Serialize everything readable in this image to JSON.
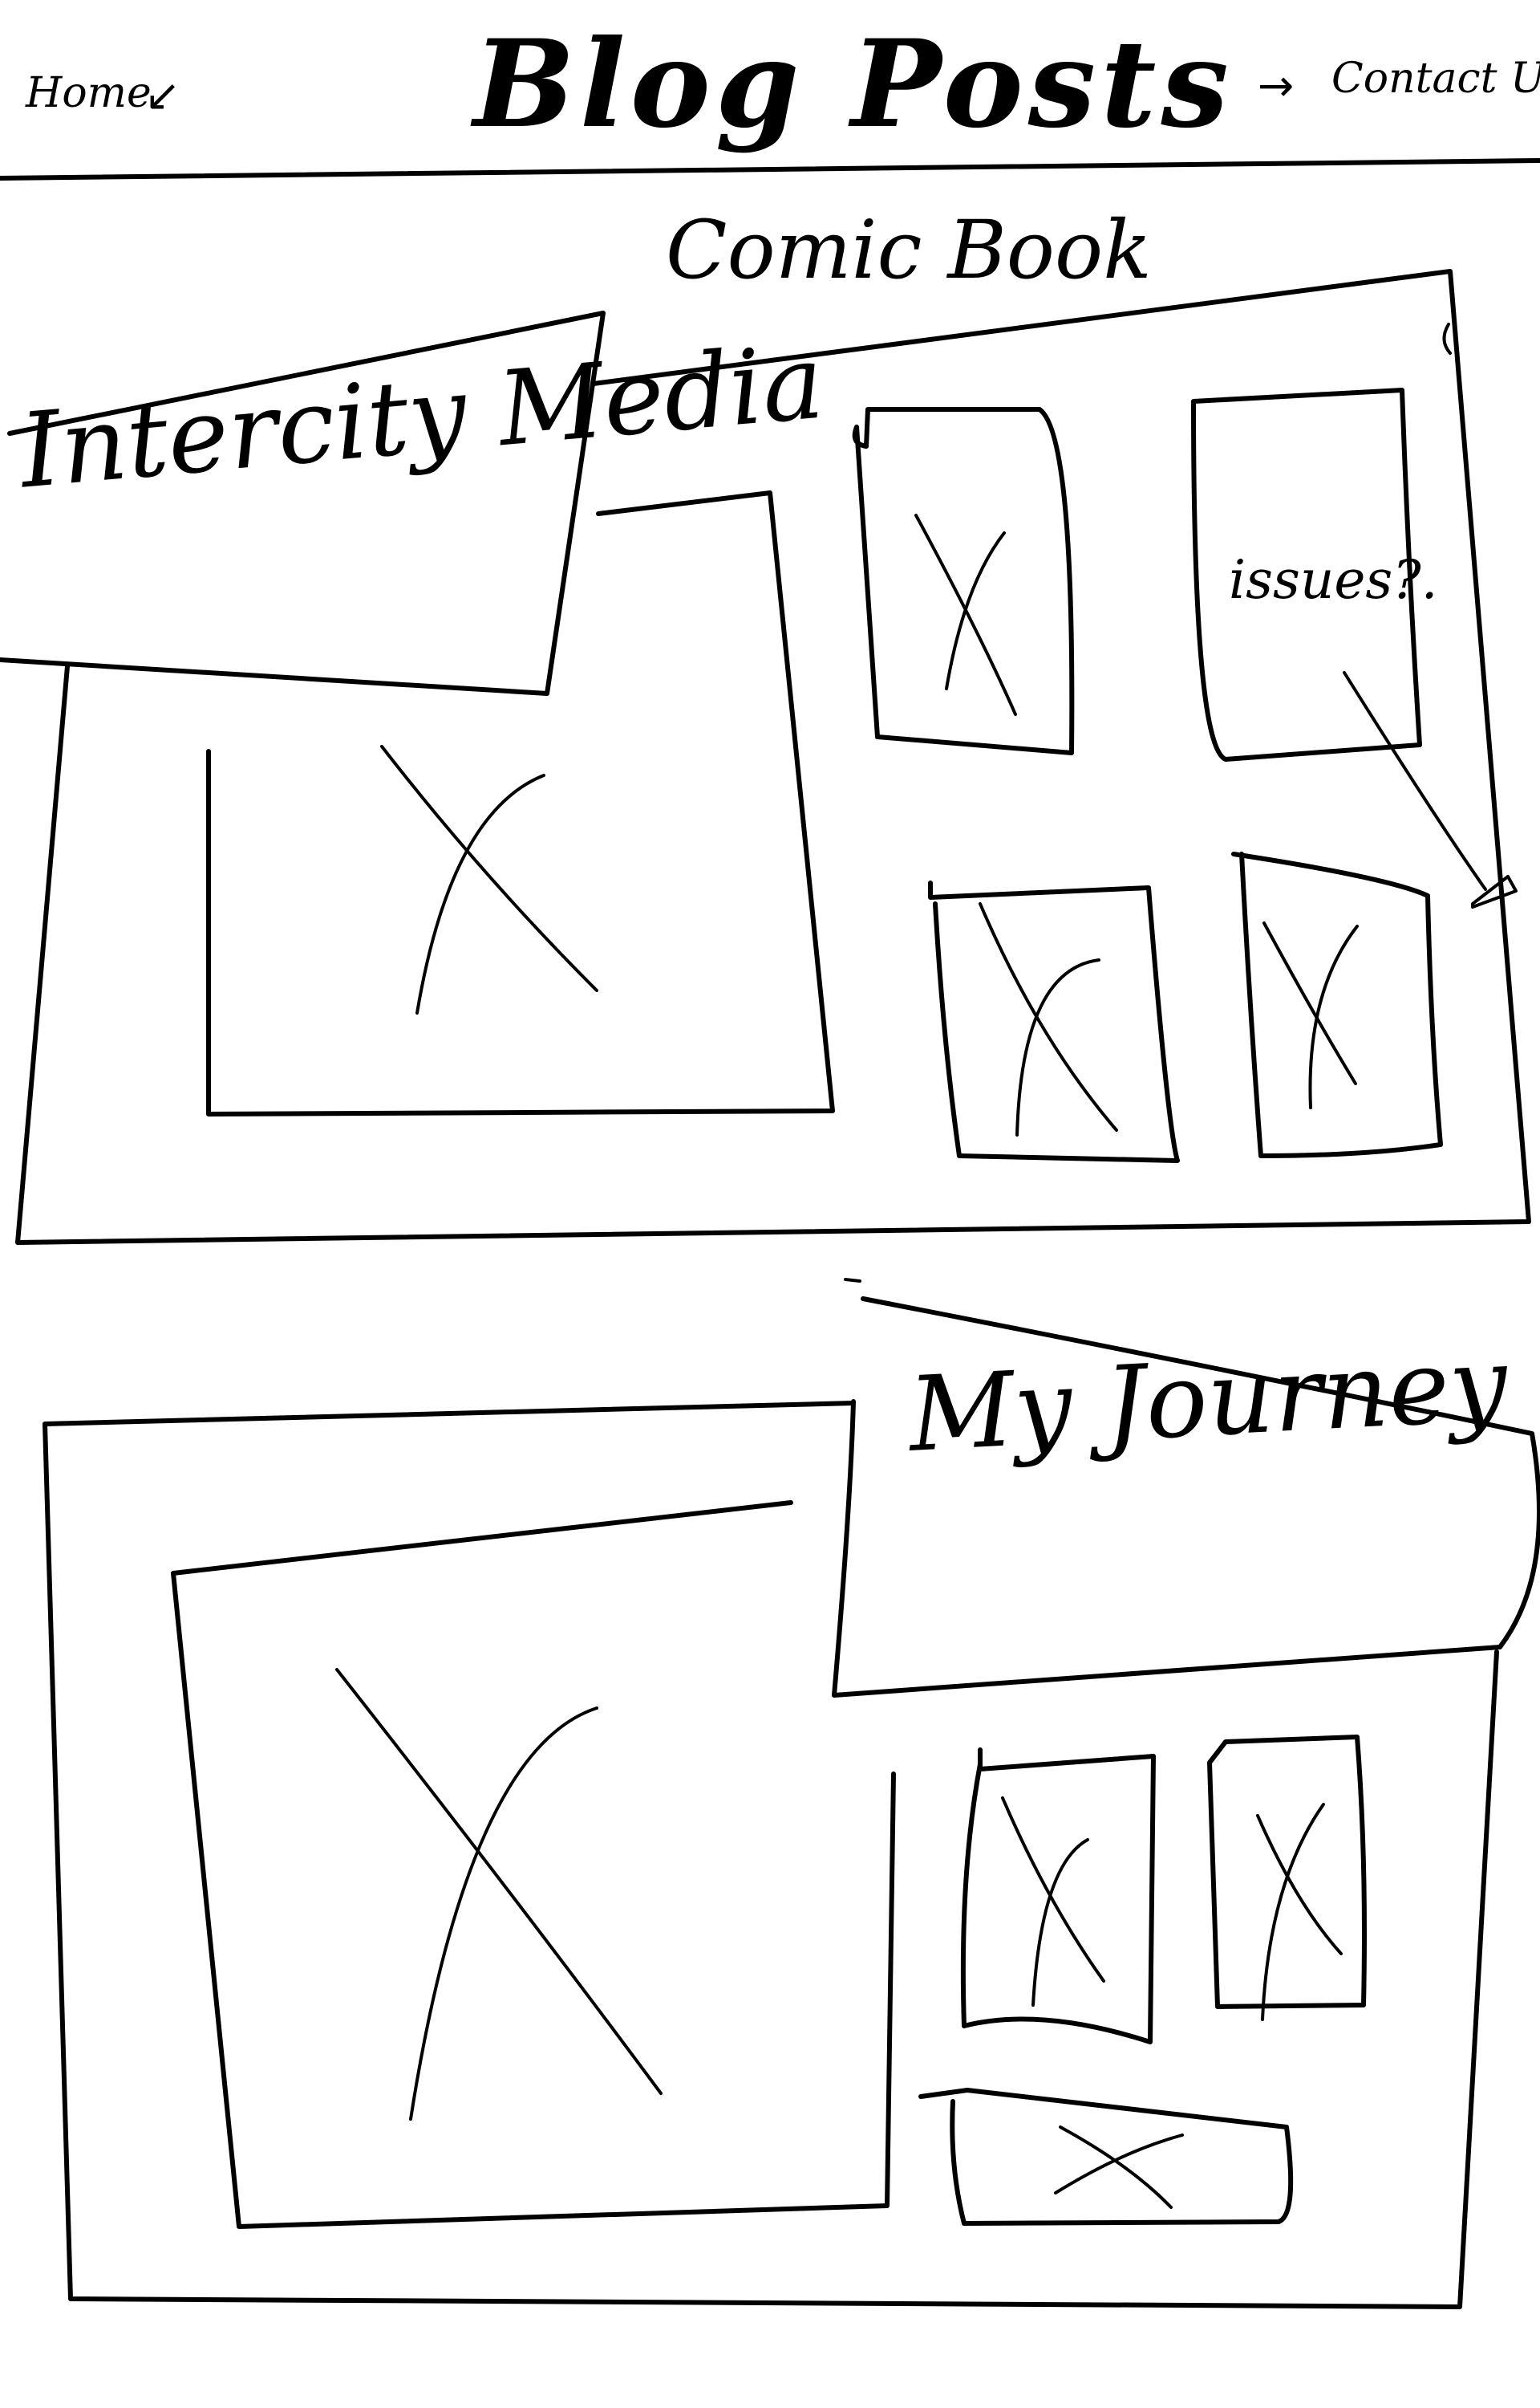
{
  "header": {
    "nav_home_label": "Home",
    "nav_home_arrow": "↙",
    "title": "Blog Posts",
    "nav_contact_arrow": "→",
    "nav_contact_label": "Contact Us"
  },
  "featured_sections": [
    {
      "caption": "Comic Book",
      "banner_title": "Intercity Media",
      "annotation": "issues?.",
      "main_image_icon": "image-placeholder-icon",
      "thumbnail_count": 4
    },
    {
      "caption": "",
      "banner_title": "My Journey",
      "main_image_icon": "image-placeholder-icon",
      "thumbnail_count": 3
    }
  ],
  "colors": {
    "ink": "#000000",
    "paper": "#ffffff"
  }
}
